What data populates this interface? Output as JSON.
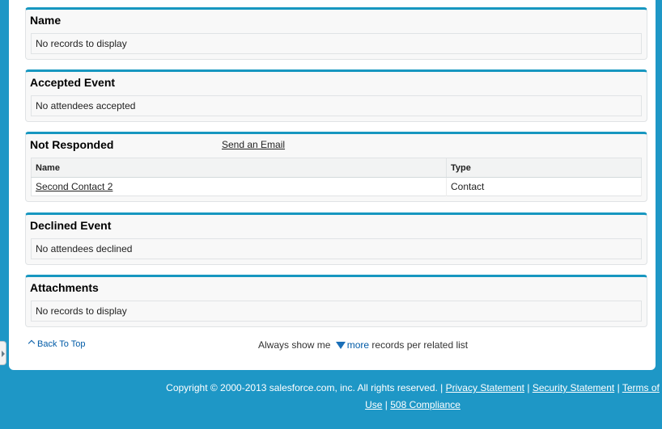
{
  "panels": {
    "name": {
      "title": "Name",
      "empty_text": "No records to display"
    },
    "accepted": {
      "title": "Accepted Event",
      "empty_text": "No attendees accepted"
    },
    "not_responded": {
      "title": "Not Responded",
      "action_link": "Send an Email",
      "columns": [
        "Name",
        "Type"
      ],
      "rows": [
        {
          "name": "Second Contact 2",
          "type": "Contact"
        }
      ]
    },
    "declined": {
      "title": "Declined Event",
      "empty_text": "No attendees declined"
    },
    "attachments": {
      "title": "Attachments",
      "empty_text": "No records to display"
    }
  },
  "footer": {
    "back_to_top": "Back To Top",
    "always_show_prefix": "Always show me",
    "more_link": "more",
    "always_show_suffix": "records per related list"
  },
  "copyright": {
    "text": "Copyright © 2000-2013 salesforce.com, inc. All rights reserved. |",
    "links": [
      "Privacy Statement",
      "Security Statement",
      "Terms of Use",
      "508 Compliance"
    ],
    "separator": "|"
  },
  "colors": {
    "page_background": "#1e97c6",
    "panel_accent": "#1797c0",
    "link_blue": "#015ba7"
  },
  "icons": {
    "sidebar_toggle": "triangle-right-icon",
    "back_to_top": "chevron-up-icon",
    "more": "triangle-down-icon"
  }
}
